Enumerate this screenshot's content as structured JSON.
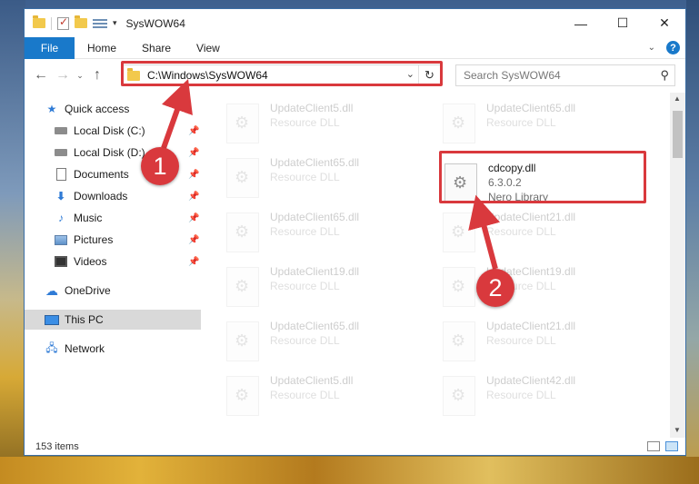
{
  "window": {
    "title": "SysWOW64"
  },
  "ribbon": {
    "tabs": [
      "File",
      "Home",
      "Share",
      "View"
    ]
  },
  "address": {
    "path": "C:\\Windows\\SysWOW64"
  },
  "search": {
    "placeholder": "Search SysWOW64"
  },
  "sidebar": {
    "items": [
      {
        "label": "Quick access",
        "icon": "star-icon"
      },
      {
        "label": "Local Disk (C:)",
        "icon": "disk-icon"
      },
      {
        "label": "Local Disk (D:)",
        "icon": "disk-icon"
      },
      {
        "label": "Documents",
        "icon": "documents-icon"
      },
      {
        "label": "Downloads",
        "icon": "downloads-icon"
      },
      {
        "label": "Music",
        "icon": "music-icon"
      },
      {
        "label": "Pictures",
        "icon": "pictures-icon"
      },
      {
        "label": "Videos",
        "icon": "videos-icon"
      },
      {
        "label": "OneDrive",
        "icon": "cloud-icon"
      },
      {
        "label": "This PC",
        "icon": "computer-icon"
      },
      {
        "label": "Network",
        "icon": "network-icon"
      }
    ]
  },
  "files": {
    "left": [
      {
        "name": "UpdateClient5.dll",
        "sub": "Resource DLL"
      },
      {
        "name": "UpdateClient65.dll",
        "sub": "Resource DLL"
      },
      {
        "name": "UpdateClient65.dll",
        "sub": "Resource DLL"
      },
      {
        "name": "UpdateClient19.dll",
        "sub": "Resource DLL"
      },
      {
        "name": "UpdateClient65.dll",
        "sub": "Resource DLL"
      },
      {
        "name": "UpdateClient5.dll",
        "sub": "Resource DLL"
      }
    ],
    "right": [
      {
        "name": "UpdateClient65.dll",
        "sub": "Resource DLL"
      },
      {
        "name": "cdcopy.dll",
        "sub": "6.3.0.2",
        "sub2": "Nero Library"
      },
      {
        "name": "UpdateClient21.dll",
        "sub": "Resource DLL"
      },
      {
        "name": "UpdateClient19.dll",
        "sub": "Resource DLL"
      },
      {
        "name": "UpdateClient21.dll",
        "sub": "Resource DLL"
      },
      {
        "name": "UpdateClient42.dll",
        "sub": "Resource DLL"
      }
    ]
  },
  "status": {
    "items_count": "153 items"
  },
  "annotations": {
    "step1": "1",
    "step2": "2",
    "color": "#d9393d"
  }
}
